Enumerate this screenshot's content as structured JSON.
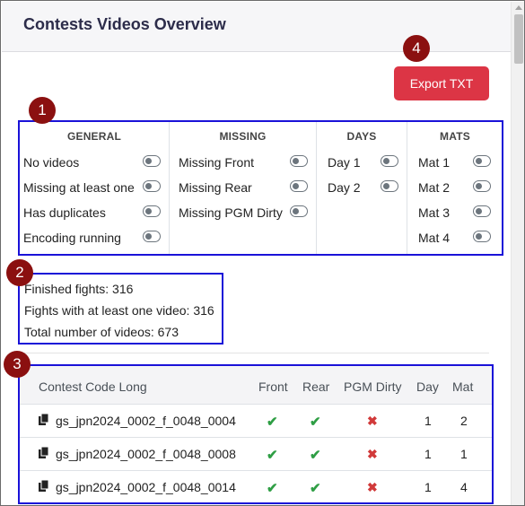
{
  "header": {
    "title": "Contests Videos Overview"
  },
  "toolbar": {
    "export_label": "Export TXT"
  },
  "markers": [
    "1",
    "2",
    "3",
    "4"
  ],
  "filters": {
    "general": {
      "title": "GENERAL",
      "items": [
        "No videos",
        "Missing at least one",
        "Has duplicates",
        "Encoding running"
      ]
    },
    "missing": {
      "title": "MISSING",
      "items": [
        "Missing Front",
        "Missing Rear",
        "Missing PGM Dirty"
      ]
    },
    "days": {
      "title": "DAYS",
      "items": [
        "Day 1",
        "Day 2"
      ]
    },
    "mats": {
      "title": "MATS",
      "items": [
        "Mat 1",
        "Mat 2",
        "Mat 3",
        "Mat 4"
      ]
    }
  },
  "stats": {
    "finished": "Finished fights: 316",
    "with_video": "Fights with at least one video: 316",
    "total_videos": "Total number of videos: 673"
  },
  "table": {
    "headers": [
      "Contest Code Long",
      "Front",
      "Rear",
      "PGM Dirty",
      "Day",
      "Mat"
    ],
    "rows": [
      {
        "code": "gs_jpn2024_0002_f_0048_0004",
        "front": "✔",
        "rear": "✔",
        "pgm": "✖",
        "day": "1",
        "mat": "2"
      },
      {
        "code": "gs_jpn2024_0002_f_0048_0008",
        "front": "✔",
        "rear": "✔",
        "pgm": "✖",
        "day": "1",
        "mat": "1"
      },
      {
        "code": "gs_jpn2024_0002_f_0048_0014",
        "front": "✔",
        "rear": "✔",
        "pgm": "✖",
        "day": "1",
        "mat": "4"
      }
    ]
  },
  "icons": {
    "file": "file-copy-icon",
    "check": "check-icon",
    "cross": "cross-icon"
  },
  "colors": {
    "danger": "#dc3545",
    "success": "#2e9e44",
    "marker": "#8b1010",
    "highlight": "#1a12d8"
  }
}
